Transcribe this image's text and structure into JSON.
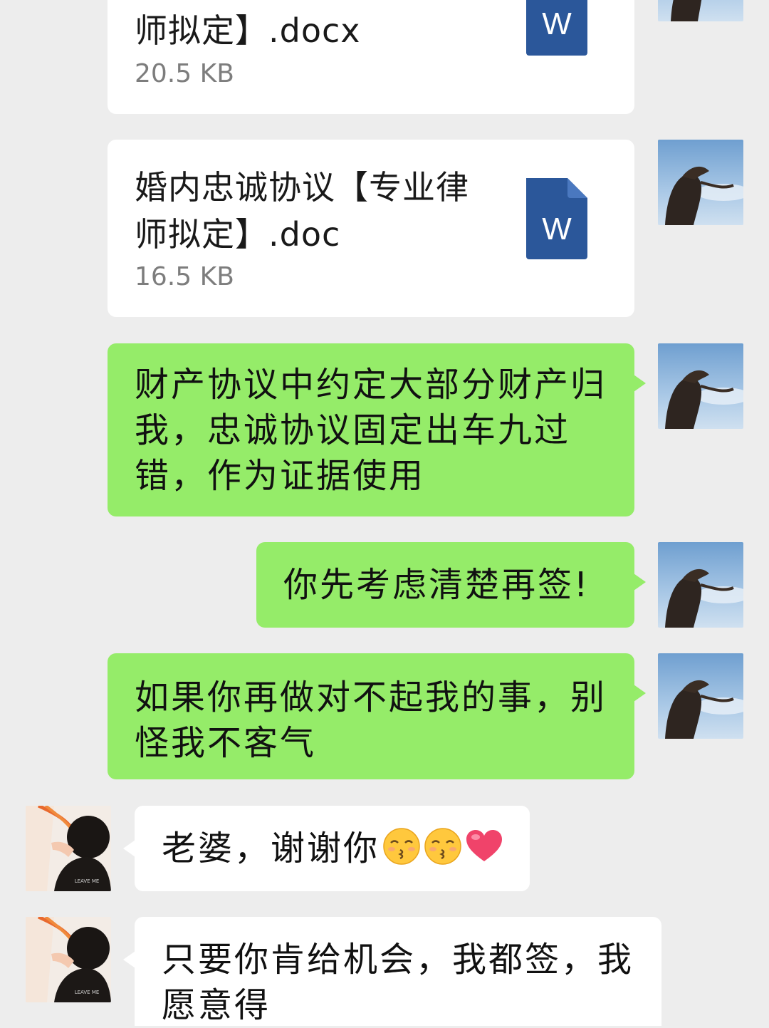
{
  "messages": [
    {
      "id": "file_docx",
      "type": "file",
      "side": "right",
      "title": "师拟定】.docx",
      "size": "20.5 KB",
      "file_icon": "word-doc-icon",
      "icon_letter": "W"
    },
    {
      "id": "file_doc",
      "type": "file",
      "side": "right",
      "title": "婚内忠诚协议【专业律师拟定】.doc",
      "size": "16.5 KB",
      "file_icon": "word-doc-icon",
      "icon_letter": "W"
    },
    {
      "id": "msg_property",
      "type": "text",
      "side": "right",
      "text": "财产协议中约定大部分财产归我，忠诚协议固定出车九过错，作为证据使用"
    },
    {
      "id": "msg_consider",
      "type": "text",
      "side": "right",
      "text": "你先考虑清楚再签!"
    },
    {
      "id": "msg_warning",
      "type": "text",
      "side": "right",
      "text": "如果你再做对不起我的事，别怪我不客气"
    },
    {
      "id": "msg_thanks",
      "type": "text",
      "side": "left",
      "text": "老婆，谢谢你",
      "emojis": [
        "kissing-face-emoji",
        "kissing-face-emoji",
        "red-heart-emoji"
      ]
    },
    {
      "id": "msg_willing",
      "type": "text",
      "side": "left",
      "text": "只要你肯给机会，我都签，我愿意得"
    }
  ],
  "colors": {
    "background": "#ededed",
    "bubble_sent": "#95ec69",
    "bubble_received": "#ffffff",
    "word_icon": "#2b579a",
    "file_size_text": "#7d7d7d"
  }
}
